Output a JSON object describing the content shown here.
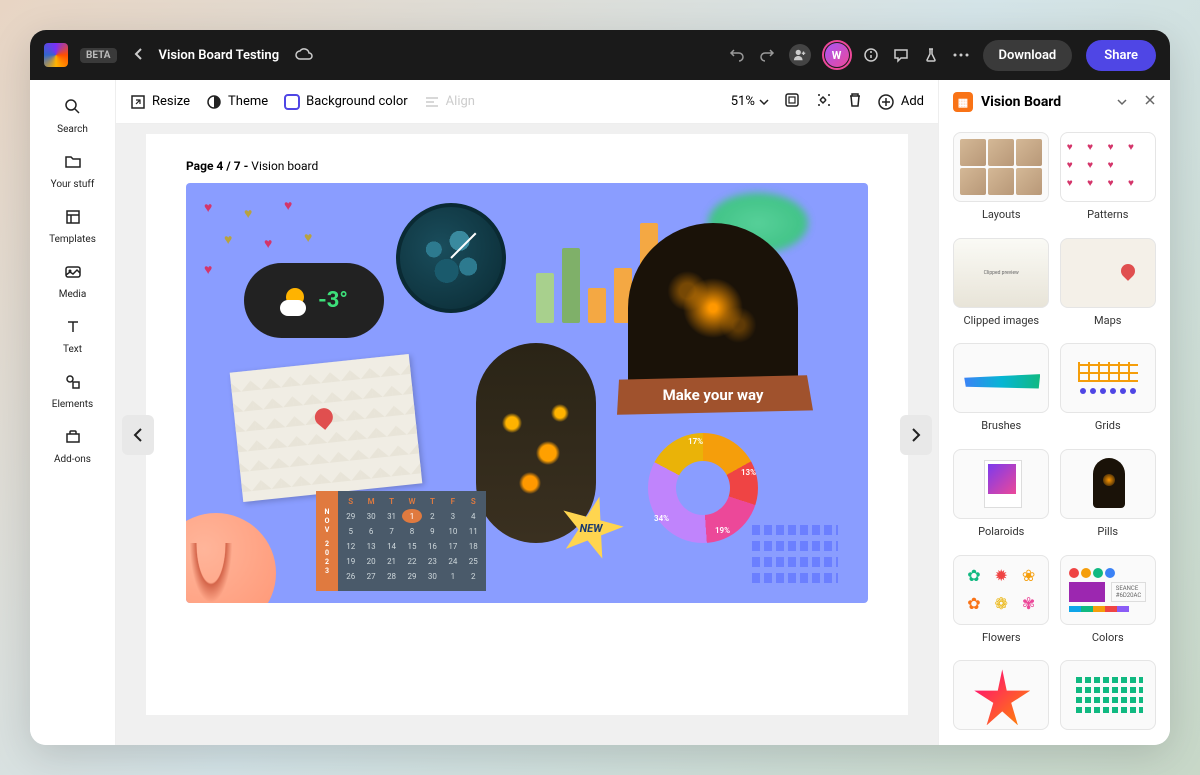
{
  "header": {
    "beta": "BETA",
    "title": "Vision Board Testing",
    "download": "Download",
    "share": "Share",
    "avatar": "W"
  },
  "leftnav": [
    {
      "icon": "search",
      "label": "Search"
    },
    {
      "icon": "folder",
      "label": "Your stuff"
    },
    {
      "icon": "templates",
      "label": "Templates"
    },
    {
      "icon": "media",
      "label": "Media"
    },
    {
      "icon": "text",
      "label": "Text"
    },
    {
      "icon": "elements",
      "label": "Elements"
    },
    {
      "icon": "addons",
      "label": "Add-ons"
    }
  ],
  "toolbar": {
    "resize": "Resize",
    "theme": "Theme",
    "bgcolor": "Background color",
    "align": "Align",
    "zoom": "51%",
    "add": "Add"
  },
  "page": {
    "label_prefix": "Page 4 / 7 - ",
    "label_name": "Vision board"
  },
  "canvas": {
    "weather_temp": "-3°",
    "banner": "Make your way",
    "new_badge": "NEW",
    "donut_pcts": [
      "17%",
      "13%",
      "19%",
      "34%"
    ],
    "cal_month": [
      "N",
      "O",
      "V"
    ],
    "cal_year": [
      "2",
      "0",
      "2",
      "3"
    ],
    "cal_days": [
      "S",
      "M",
      "T",
      "W",
      "T",
      "F",
      "S"
    ]
  },
  "panel": {
    "title": "Vision Board",
    "items": [
      "Layouts",
      "Patterns",
      "Clipped images",
      "Maps",
      "Brushes",
      "Grids",
      "Polaroids",
      "Pills",
      "Flowers",
      "Colors"
    ],
    "color_hex": "#6D20AC",
    "color_name": "SEANCE"
  }
}
